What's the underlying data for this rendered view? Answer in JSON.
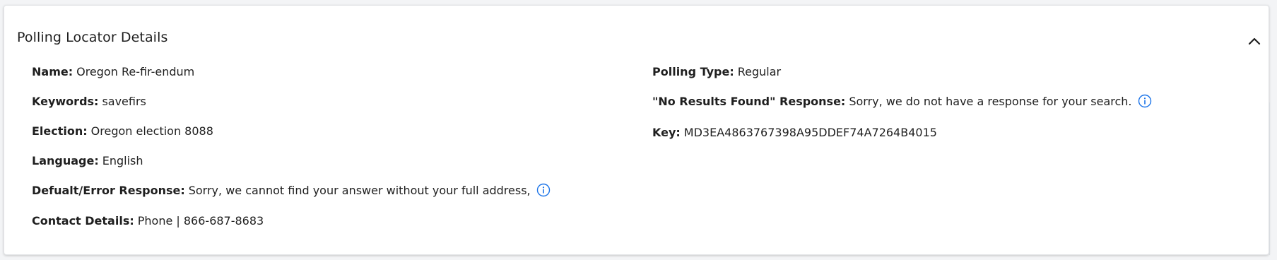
{
  "panel": {
    "title": "Polling Locator Details",
    "collapse_icon": "chevron-up-icon"
  },
  "left_fields": [
    {
      "label": "Name:",
      "value": "Oregon Re-fir-endum"
    },
    {
      "label": "Keywords:",
      "value": "savefirs"
    },
    {
      "label": "Election:",
      "value": "Oregon election 8088"
    },
    {
      "label": "Language:",
      "value": "English"
    },
    {
      "label": "Defualt/Error Response:",
      "value": "Sorry, we cannot find your answer without your full address,",
      "icon": "info-icon"
    },
    {
      "label": "Contact Details:",
      "value": "Phone | 866-687-8683"
    }
  ],
  "right_fields": [
    {
      "label": "Polling Type:",
      "value": "Regular"
    },
    {
      "label": "\"No Results Found\" Response:",
      "value": "Sorry, we do not have a response for your search.",
      "icon": "info-icon"
    },
    {
      "label": "Key:",
      "value": "MD3EA4863767398A95DDEF74A7264B4015"
    }
  ],
  "colors": {
    "info_icon": "#1a73e8",
    "text": "#1f1f1f",
    "card_bg": "#ffffff",
    "page_bg": "#f3f4f6"
  }
}
